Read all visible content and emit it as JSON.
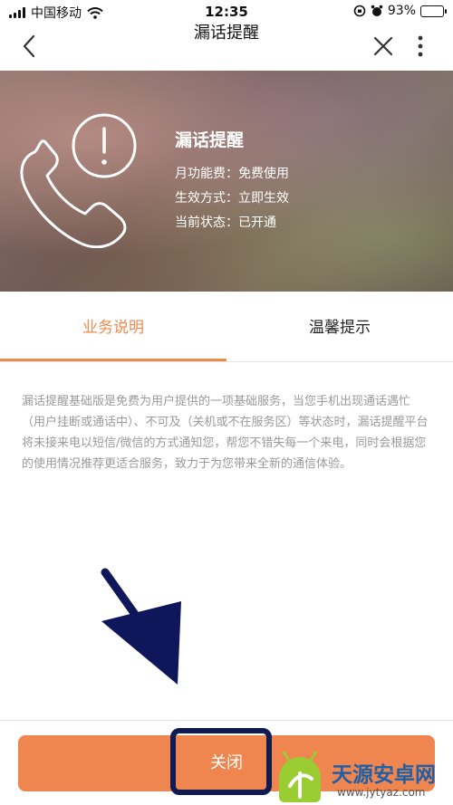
{
  "status_bar": {
    "carrier": "中国移动",
    "time": "12:35",
    "battery_percent": "93%",
    "battery_level": 0.93,
    "icons": [
      "signal-icon",
      "wifi-icon",
      "rotation-lock-icon",
      "alarm-icon",
      "battery-icon"
    ]
  },
  "nav": {
    "title": "漏话提醒",
    "icons": [
      "back-icon",
      "close-icon",
      "more-icon"
    ]
  },
  "banner": {
    "title": "漏话提醒",
    "monthly_fee": "月功能费：免费使用",
    "effective": "生效方式：立即生效",
    "status": "当前状态：已开通",
    "icon": "phone-alert-icon"
  },
  "tabs": [
    {
      "label": "业务说明",
      "active": true
    },
    {
      "label": "温馨提示",
      "active": false
    }
  ],
  "content": {
    "description": "漏话提醒基础版是免费为用户提供的一项基础服务，当您手机出现通话遇忙（用户挂断或通话中）、不可及（关机或不在服务区）等状态时，漏话提醒平台将未接来电以短信/微信的方式通知您，帮您不错失每一个来电，同时会根据您的使用情况推荐更适合服务，致力于为您带来全新的通信体验。"
  },
  "bottom": {
    "close_label": "关闭"
  },
  "watermark": {
    "title": "天源安卓网",
    "url": "www.jytyaz.com"
  },
  "colors": {
    "accent": "#f0864f",
    "highlight_border": "#121a52",
    "arrow": "#10165a"
  }
}
